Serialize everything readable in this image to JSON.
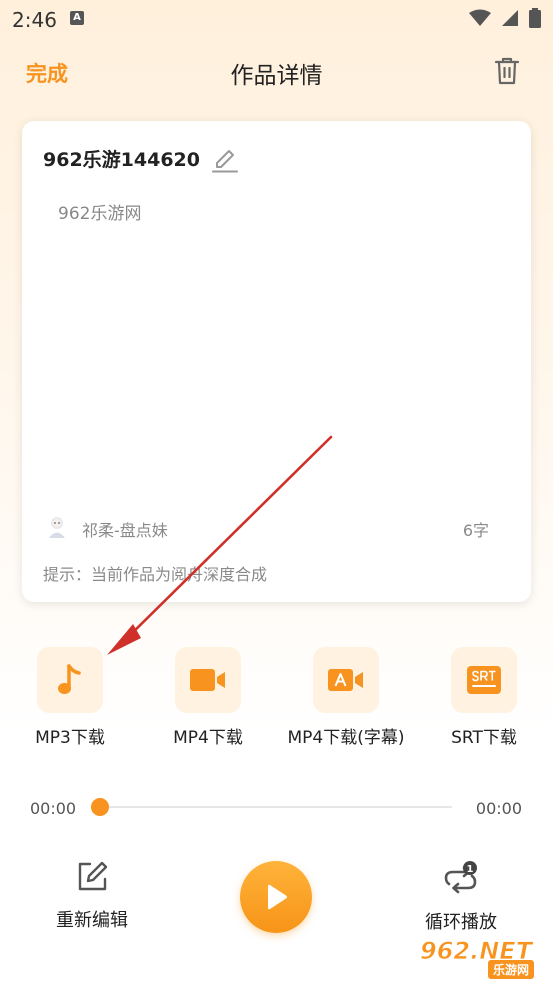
{
  "status_bar": {
    "time": "2:46",
    "notif_letter": "A"
  },
  "header": {
    "done_label": "完成",
    "title": "作品详情"
  },
  "card": {
    "work_name": "962乐游144620",
    "content": "962乐游网",
    "voice_name": "祁柔-盘点妹",
    "char_count": "6字",
    "hint": "提示：当前作品为阅舟深度合成"
  },
  "downloads": [
    {
      "label": "MP3下载",
      "icon": "music-note-icon"
    },
    {
      "label": "MP4下载",
      "icon": "video-camera-icon"
    },
    {
      "label": "MP4下载(字幕)",
      "icon": "video-subtitle-icon"
    },
    {
      "label": "SRT下载",
      "icon": "srt-file-icon"
    }
  ],
  "player": {
    "current_time": "00:00",
    "total_time": "00:00",
    "progress": 0
  },
  "controls": {
    "reedit_label": "重新编辑",
    "loop_label": "循环播放",
    "loop_badge": "1"
  },
  "watermark": {
    "brand": "962.NET",
    "sub": "乐游网"
  },
  "colors": {
    "accent": "#F7931E",
    "tile_bg": "#FFF2E0",
    "annotation": "#D0302A"
  }
}
